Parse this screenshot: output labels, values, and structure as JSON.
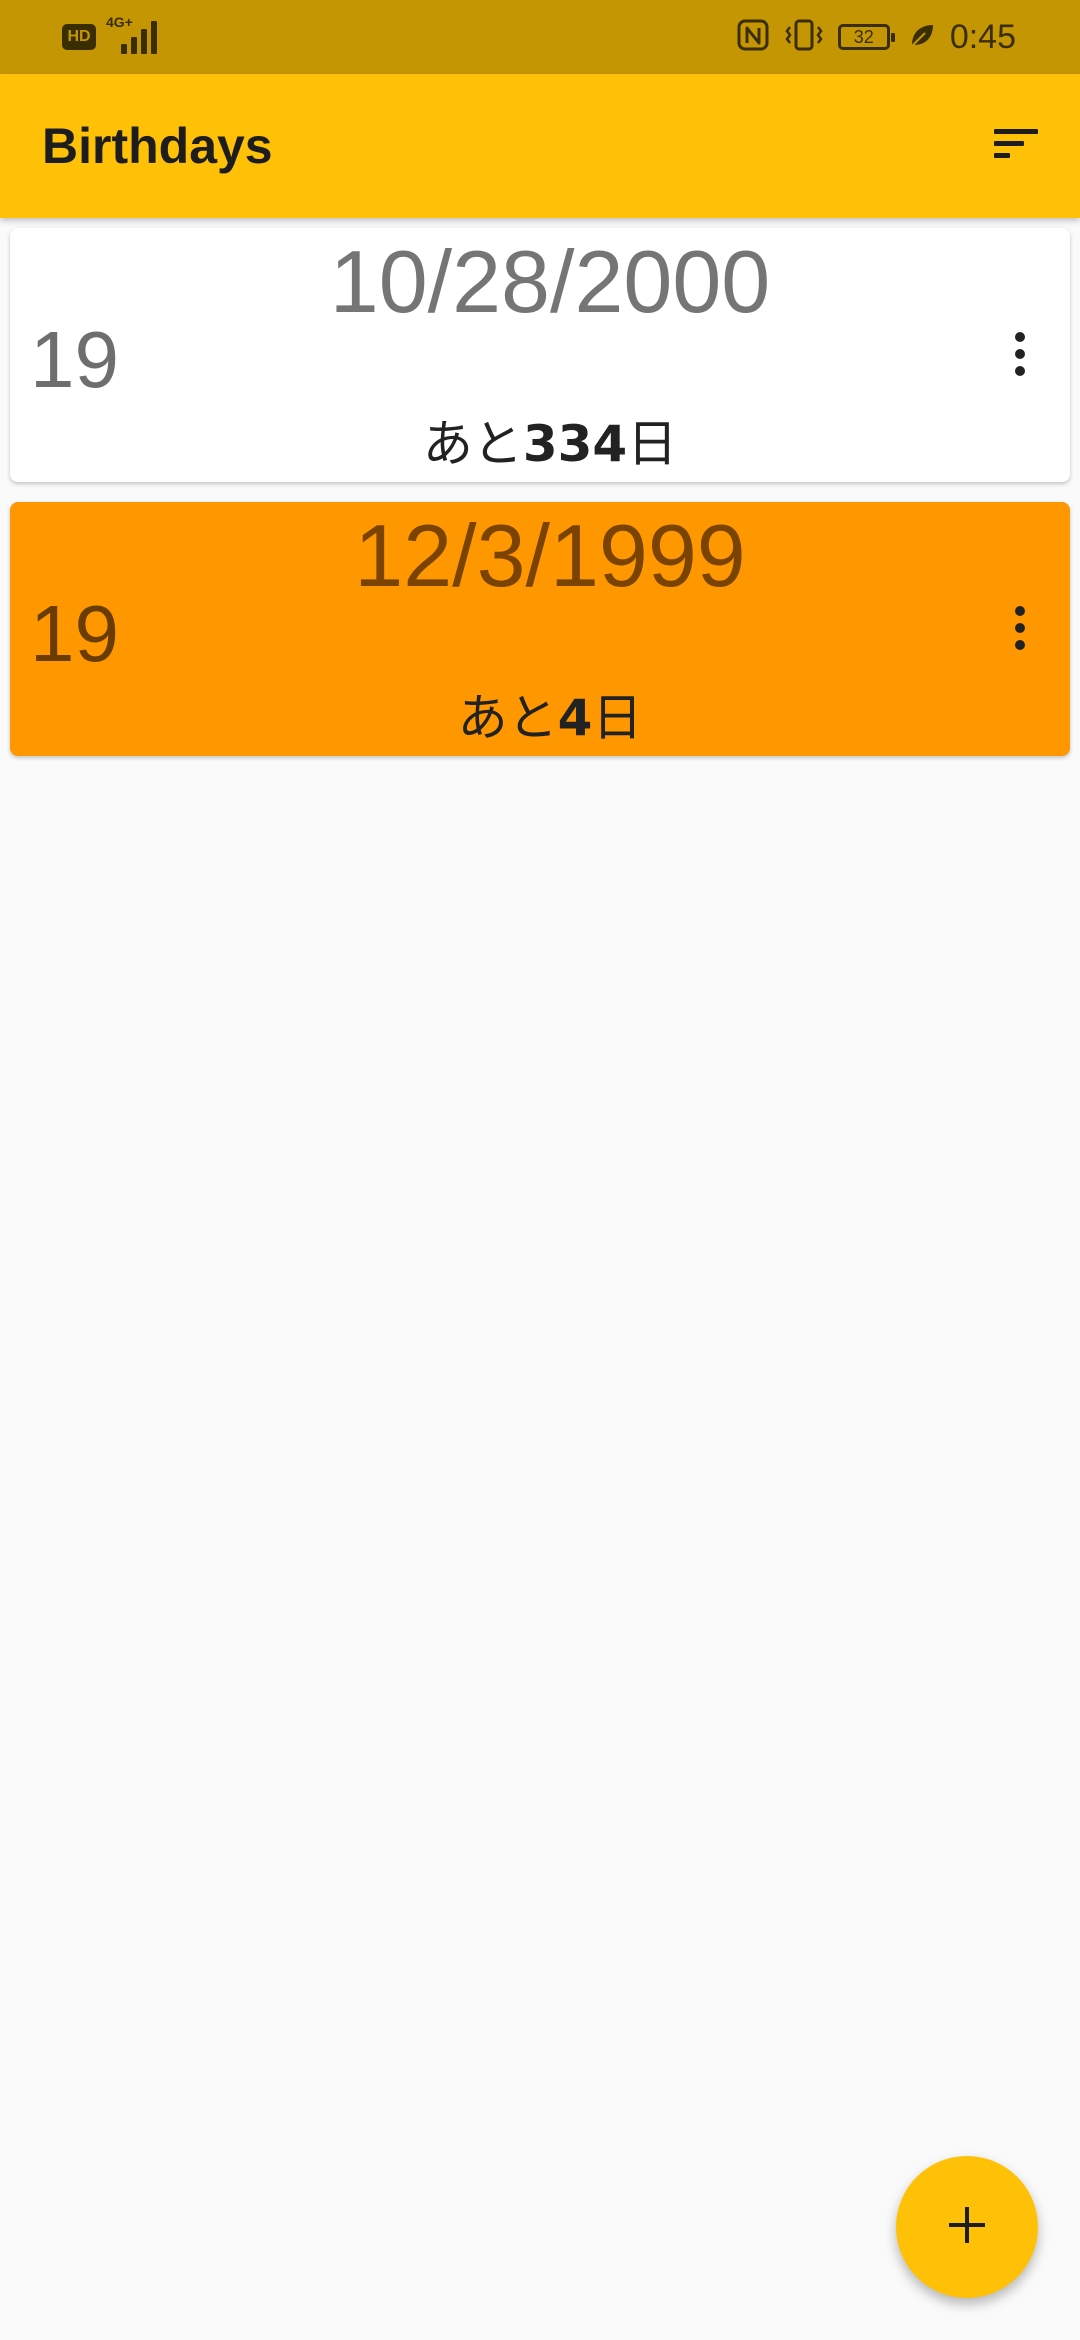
{
  "status_bar": {
    "hd_label": "HD",
    "network_label": "4G+",
    "battery_level": "32",
    "time": "0:45",
    "icons": [
      "hd-icon",
      "signal-icon",
      "nfc-icon",
      "vibrate-icon",
      "battery-icon",
      "leaf-icon"
    ]
  },
  "app_bar": {
    "title": "Birthdays",
    "sort_icon": "sort-icon"
  },
  "birthdays": [
    {
      "date": "10/28/2000",
      "age": "19",
      "remaining_prefix": "あと",
      "remaining_days": "334",
      "remaining_suffix": "日",
      "highlight": false
    },
    {
      "date": "12/3/1999",
      "age": "19",
      "remaining_prefix": "あと",
      "remaining_days": "4",
      "remaining_suffix": "日",
      "highlight": true
    }
  ],
  "fab": {
    "icon": "add-icon"
  },
  "colors": {
    "status_bar": "#c49604",
    "app_bar": "#ffc107",
    "card_default": "#ffffff",
    "card_highlight": "#ff9800",
    "background": "#fafafa",
    "fab": "#ffc107"
  }
}
